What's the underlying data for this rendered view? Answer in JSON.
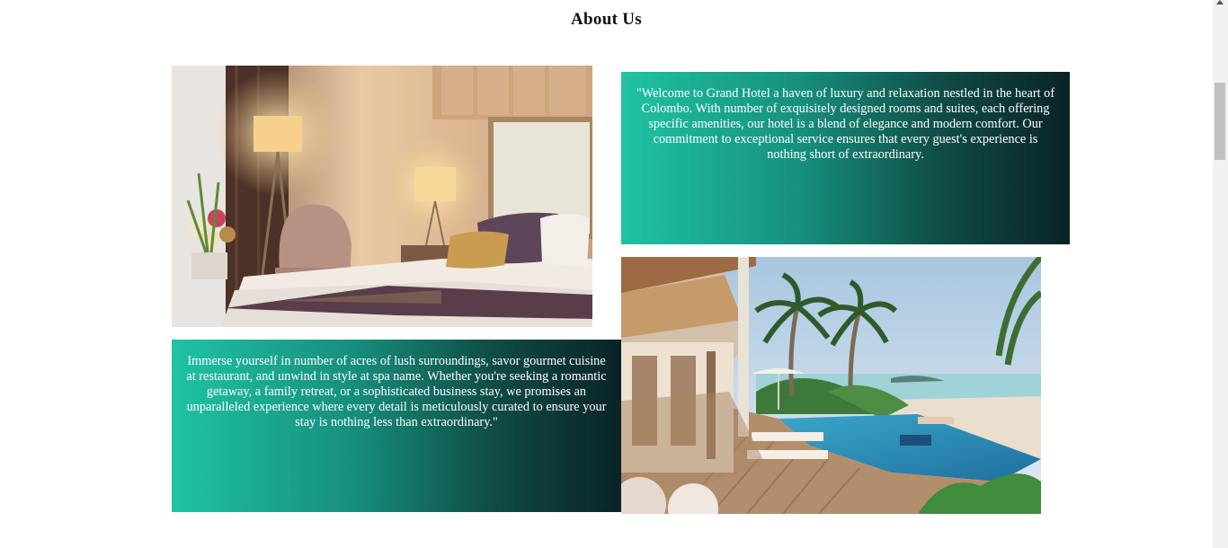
{
  "section": {
    "title": "About Us"
  },
  "images": {
    "room_photo": "hotel-bedroom-photo",
    "resort_photo": "resort-pool-photo"
  },
  "paragraphs": {
    "intro": "\"Welcome to Grand Hotel a haven of luxury and relaxation nestled in the heart of Colombo. With number of exquisitely designed rooms and suites, each offering specific amenities, our hotel is a blend of elegance and modern comfort. Our commitment to exceptional service ensures that every guest's experience is nothing short of extraordinary.",
    "details": "Immerse yourself in number of acres of lush surroundings, savor gourmet cuisine at restaurant, and unwind in style at spa name. Whether you're seeking a romantic getaway, a family retreat, or a sophisticated business stay, we promises an unparalleled experience where every detail is meticulously curated to ensure your stay is nothing less than extraordinary.\""
  },
  "colors": {
    "gradient_start": "#1fc3a3",
    "gradient_end": "#0a2326"
  }
}
